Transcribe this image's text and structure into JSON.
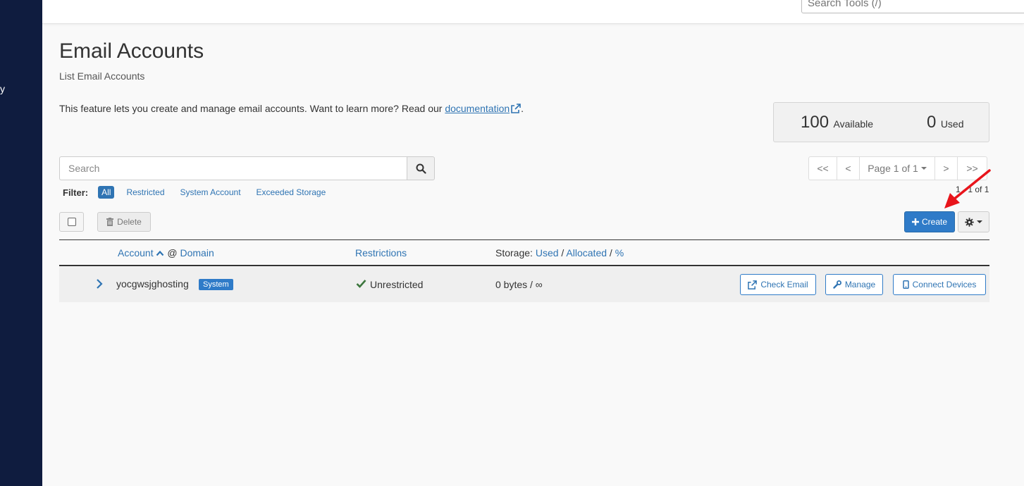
{
  "sidebar": {
    "fragment_text": "y"
  },
  "topbar": {
    "search_placeholder": "Search Tools (/)"
  },
  "header": {
    "title": "Email Accounts",
    "subtitle": "List Email Accounts"
  },
  "intro": {
    "text": "This feature lets you create and manage email accounts. Want to learn more? Read our ",
    "link_text": "documentation",
    "suffix": "."
  },
  "stats": {
    "available_value": "100",
    "available_label": "Available",
    "used_value": "0",
    "used_label": "Used"
  },
  "search": {
    "placeholder": "Search"
  },
  "pagination": {
    "first": "<<",
    "prev": "<",
    "page_label": "Page 1 of 1",
    "next": ">",
    "last": ">>",
    "range": "1 - 1 of 1"
  },
  "filter": {
    "label": "Filter:",
    "options": [
      "All",
      "Restricted",
      "System Account",
      "Exceeded Storage"
    ],
    "active": "All"
  },
  "toolbar": {
    "delete_label": "Delete",
    "create_label": "Create"
  },
  "table": {
    "columns": {
      "account": "Account",
      "at": "@",
      "domain": "Domain",
      "restrictions": "Restrictions",
      "storage_prefix": "Storage:",
      "storage_used": "Used",
      "storage_allocated": "Allocated",
      "storage_percent": "%"
    },
    "rows": [
      {
        "account": "yocgwsjghosting",
        "badge": "System",
        "restriction": "Unrestricted",
        "storage": "0 bytes / ∞",
        "actions": {
          "check_email": "Check Email",
          "manage": "Manage",
          "connect_devices": "Connect Devices"
        }
      }
    ]
  },
  "colors": {
    "sidebar": "#0f1c3f",
    "primary": "#2f7bc8",
    "link": "#2f74b3",
    "success": "#3c763d",
    "annotation": "#e8141b"
  }
}
